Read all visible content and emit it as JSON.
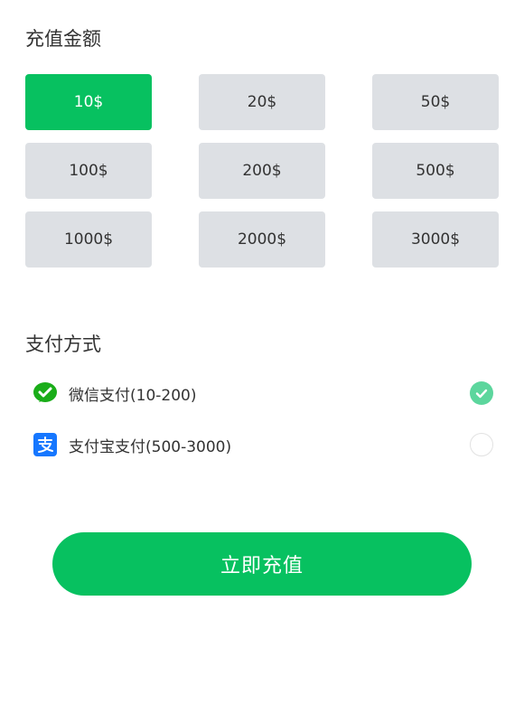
{
  "recharge": {
    "title": "充值金额",
    "amounts": [
      {
        "label": "10$",
        "selected": true
      },
      {
        "label": "20$",
        "selected": false
      },
      {
        "label": "50$",
        "selected": false
      },
      {
        "label": "100$",
        "selected": false
      },
      {
        "label": "200$",
        "selected": false
      },
      {
        "label": "500$",
        "selected": false
      },
      {
        "label": "1000$",
        "selected": false
      },
      {
        "label": "2000$",
        "selected": false
      },
      {
        "label": "3000$",
        "selected": false
      }
    ]
  },
  "payment": {
    "title": "支付方式",
    "methods": [
      {
        "label": "微信支付(10-200)",
        "icon": "wechat-pay-icon",
        "checked": true
      },
      {
        "label": "支付宝支付(500-3000)",
        "icon": "alipay-icon",
        "checked": false
      }
    ]
  },
  "submit": {
    "label": "立即充值"
  },
  "colors": {
    "accent": "#07c160",
    "check": "#5cd69d",
    "button_bg": "#dde0e4",
    "alipay": "#1677ff",
    "wechat": "#1aad19"
  }
}
